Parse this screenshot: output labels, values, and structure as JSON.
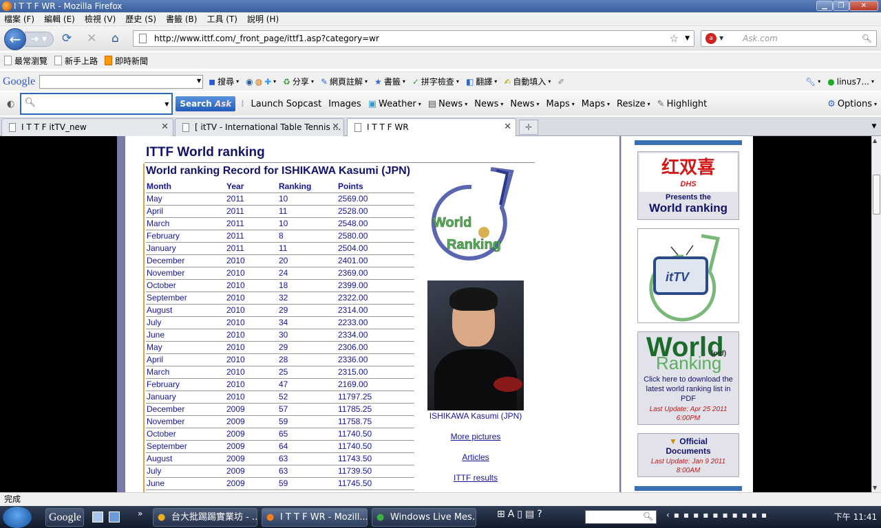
{
  "window": {
    "title": "I T T F WR - Mozilla Firefox"
  },
  "menu": [
    "檔案 (F)",
    "編輯 (E)",
    "檢視 (V)",
    "歷史 (S)",
    "書籤 (B)",
    "工具 (T)",
    "說明 (H)"
  ],
  "nav": {
    "url": "http://www.ittf.com/_front_page/ittf1.asp?category=wr",
    "search_placeholder": "Ask.com"
  },
  "bookmarks": [
    "最常瀏覽",
    "新手上路",
    "即時新聞"
  ],
  "google_toolbar": {
    "logo": "Google",
    "items": [
      "搜尋",
      "分享",
      "網頁註解",
      "書籤",
      "拼字檢查",
      "翻譯",
      "自動填入"
    ],
    "user": "linus7..."
  },
  "ask_toolbar": {
    "search_button": "Search",
    "items": [
      "Launch Sopcast",
      "Images",
      "Weather",
      "News",
      "News",
      "News",
      "Maps",
      "Maps",
      "Resize",
      "Highlight"
    ],
    "options": "Options"
  },
  "tabs": [
    {
      "label": "I T T F itTV_new"
    },
    {
      "label": "[ itTV - International Table Tennis ..."
    },
    {
      "label": "I T T F WR"
    }
  ],
  "page": {
    "title": "ITTF World ranking",
    "subtitle": "World ranking Record for ISHIKAWA Kasumi (JPN)",
    "headers": [
      "Month",
      "Year",
      "Ranking",
      "Points"
    ],
    "rows": [
      [
        "May",
        "2011",
        "10",
        "2569.00"
      ],
      [
        "April",
        "2011",
        "11",
        "2528.00"
      ],
      [
        "March",
        "2011",
        "10",
        "2548.00"
      ],
      [
        "February",
        "2011",
        "8",
        "2580.00"
      ],
      [
        "January",
        "2011",
        "11",
        "2504.00"
      ],
      [
        "December",
        "2010",
        "20",
        "2401.00"
      ],
      [
        "November",
        "2010",
        "24",
        "2369.00"
      ],
      [
        "October",
        "2010",
        "18",
        "2399.00"
      ],
      [
        "September",
        "2010",
        "32",
        "2322.00"
      ],
      [
        "August",
        "2010",
        "29",
        "2314.00"
      ],
      [
        "July",
        "2010",
        "34",
        "2233.00"
      ],
      [
        "June",
        "2010",
        "30",
        "2334.00"
      ],
      [
        "May",
        "2010",
        "29",
        "2306.00"
      ],
      [
        "April",
        "2010",
        "28",
        "2336.00"
      ],
      [
        "March",
        "2010",
        "25",
        "2315.00"
      ],
      [
        "February",
        "2010",
        "47",
        "2169.00"
      ],
      [
        "January",
        "2010",
        "52",
        "11797.25"
      ],
      [
        "December",
        "2009",
        "57",
        "11785.25"
      ],
      [
        "November",
        "2009",
        "59",
        "11758.75"
      ],
      [
        "October",
        "2009",
        "65",
        "11740.50"
      ],
      [
        "September",
        "2009",
        "64",
        "11740.50"
      ],
      [
        "August",
        "2009",
        "63",
        "11743.50"
      ],
      [
        "July",
        "2009",
        "63",
        "11739.50"
      ],
      [
        "June",
        "2009",
        "59",
        "11745.50"
      ]
    ],
    "logo_text_1": "World",
    "logo_text_2": "Ranking",
    "photo_caption": "ISHIKAWA Kasumi (JPN)",
    "links": [
      "More pictures",
      "Articles",
      "ITTF results"
    ]
  },
  "sidebar": {
    "sponsor": "红双喜",
    "sponsor_sub": "DHS",
    "presents": "Presents the",
    "wr_title": "World ranking",
    "ittv": "itTV",
    "pdf_big1": "World",
    "pdf_big2": "Ranking",
    "pdf_tag": "(pdf)",
    "pdf_text": "Click here to download the latest world ranking list in PDF",
    "pdf_update": "Last Update: Apr 25 2011 6:00PM",
    "official": "Official Documents",
    "official_update": "Last Update: Jan 9 2011 8:00AM"
  },
  "status": "完成",
  "taskbar": {
    "items": [
      "Google",
      "台大批踢踢實業坊 - ...",
      "I T T F WR - Mozill...",
      "Windows Live Mes..."
    ],
    "clock": "下午 11:41"
  }
}
